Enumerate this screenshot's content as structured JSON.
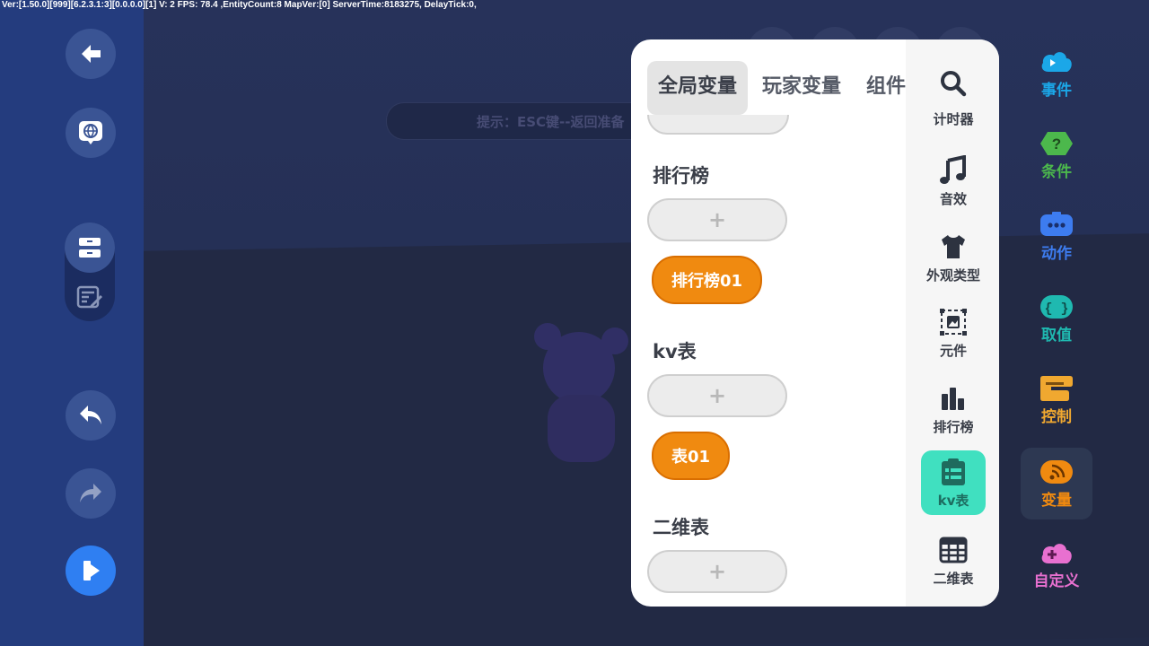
{
  "debug": {
    "text": "Ver:[1.50.0][999][6.2.3.1:3][0.0.0.0][1] V: 2 FPS: 78.4   ,EntityCount:8   MapVer:[0]   ServerTime:8183275,    DelayTick:0,"
  },
  "scene": {
    "hint": "提示：ESC键--返回准备"
  },
  "left_toolbar": {
    "buttons": [
      {
        "icon": "back-arrow-icon"
      },
      {
        "icon": "globe-card-icon"
      },
      {
        "icon": "cards-icon"
      },
      {
        "icon": "edit-list-icon"
      },
      {
        "icon": "undo-icon"
      },
      {
        "icon": "redo-icon"
      },
      {
        "icon": "run-icon"
      }
    ]
  },
  "panel": {
    "tabs": [
      {
        "label": "全局变量",
        "active": true
      },
      {
        "label": "玩家变量",
        "active": false
      },
      {
        "label": "组件变量",
        "active": false
      }
    ],
    "sections": [
      {
        "title": "排行榜",
        "add_label": "+",
        "items": [
          "排行榜01"
        ]
      },
      {
        "title": "kv表",
        "add_label": "+",
        "items": [
          "表01"
        ]
      },
      {
        "title": "二维表",
        "add_label": "+",
        "items": []
      }
    ],
    "categories": [
      {
        "label": "计时器",
        "icon": "search-icon"
      },
      {
        "label": "音效",
        "icon": "music-note-icon"
      },
      {
        "label": "外观类型",
        "icon": "shirt-icon"
      },
      {
        "label": "元件",
        "icon": "component-image-icon"
      },
      {
        "label": "排行榜",
        "icon": "bar-chart-icon"
      },
      {
        "label": "kv表",
        "icon": "clipboard-list-icon",
        "active": true
      },
      {
        "label": "二维表",
        "icon": "table-grid-icon"
      }
    ]
  },
  "right_categories": [
    {
      "label": "事件",
      "color": "#1ba7e8",
      "icon": "event-cloud-icon"
    },
    {
      "label": "条件",
      "color": "#4cb84c",
      "icon": "question-hex-icon"
    },
    {
      "label": "动作",
      "color": "#3d7cf0",
      "icon": "action-dots-icon"
    },
    {
      "label": "取值",
      "color": "#1fb9b0",
      "icon": "braces-icon"
    },
    {
      "label": "控制",
      "color": "#f0a830",
      "icon": "control-bracket-icon"
    },
    {
      "label": "变量",
      "color": "#f08a10",
      "icon": "variable-feed-icon",
      "active": true
    },
    {
      "label": "自定义",
      "color": "#e870d0",
      "icon": "custom-plus-icon"
    }
  ]
}
